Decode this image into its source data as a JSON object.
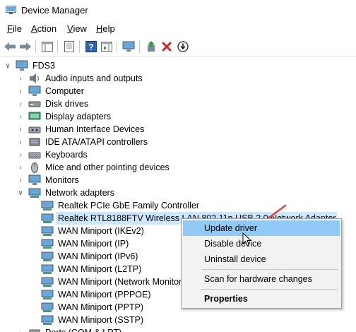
{
  "window": {
    "title": "Device Manager"
  },
  "menu": [
    {
      "label": "File",
      "mnemonic": "F",
      "rest": "ile"
    },
    {
      "label": "Action",
      "mnemonic": "A",
      "rest": "ction"
    },
    {
      "label": "View",
      "mnemonic": "V",
      "rest": "iew"
    },
    {
      "label": "Help",
      "mnemonic": "H",
      "rest": "elp"
    }
  ],
  "toolbar": {
    "icons": [
      "back-icon",
      "forward-icon",
      "show-hide-console-tree-icon",
      "properties-icon",
      "help-icon",
      "action-pane-icon",
      "computer-scan-icon",
      "update-driver-icon",
      "uninstall-device-icon",
      "enable-device-icon"
    ]
  },
  "tree": {
    "root": "FDS3",
    "categories": [
      "Audio inputs and outputs",
      "Computer",
      "Disk drives",
      "Display adapters",
      "Human Interface Devices",
      "IDE ATA/ATAPI controllers",
      "Keyboards",
      "Mice and other pointing devices",
      "Monitors",
      "Network adapters"
    ],
    "network_adapters": [
      "Realtek PCIe GbE Family Controller",
      "Realtek RTL8188FTV Wireless LAN 802.11n USB 2.0 Network Adapter",
      "WAN Miniport (IKEv2)",
      "WAN Miniport (IP)",
      "WAN Miniport (IPv6)",
      "WAN Miniport (L2TP)",
      "WAN Miniport (Network Monitor)",
      "WAN Miniport (PPPOE)",
      "WAN Miniport (PPTP)",
      "WAN Miniport (SSTP)"
    ],
    "partial_next": "Ports (COM & LPT)"
  },
  "context_menu": {
    "update_driver": "Update driver",
    "disable_device": "Disable device",
    "uninstall_device": "Uninstall device",
    "scan_hardware": "Scan for hardware changes",
    "properties": "Properties"
  },
  "colors": {
    "selection": "#cce8ff",
    "menu_highlight": "#91c9f7",
    "annotation_arrow": "#e8413b"
  }
}
